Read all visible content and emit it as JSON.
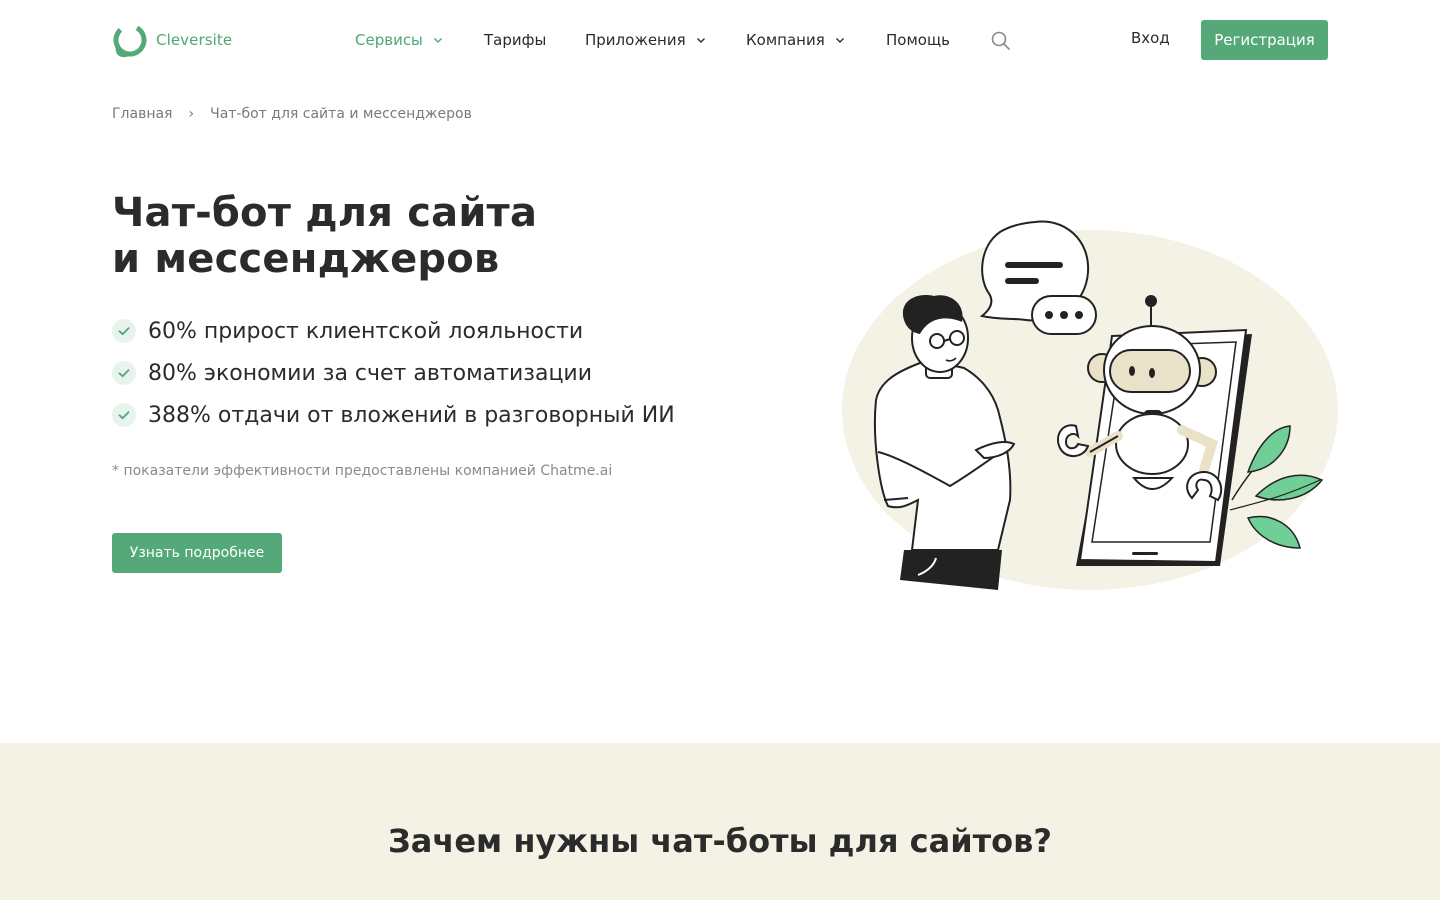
{
  "header": {
    "logo_text": "Cleversite",
    "nav": [
      {
        "label": "Сервисы",
        "has_dropdown": true,
        "active": true
      },
      {
        "label": "Тарифы",
        "has_dropdown": false,
        "active": false
      },
      {
        "label": "Приложения",
        "has_dropdown": true,
        "active": false
      },
      {
        "label": "Компания",
        "has_dropdown": true,
        "active": false
      },
      {
        "label": "Помощь",
        "has_dropdown": false,
        "active": false
      }
    ],
    "search_icon": "search-icon",
    "login_label": "Вход",
    "register_label": "Регистрация"
  },
  "breadcrumb": {
    "items": [
      "Главная",
      "Чат-бот для сайта и мессенджеров"
    ],
    "separator": "›"
  },
  "hero": {
    "title_line1": "Чат-бот для сайта",
    "title_line2": "и мессенджеров",
    "features": [
      "60% прирост клиентской лояльности",
      "80% экономии за счет автоматизации",
      "388% отдачи от вложений в разговорный ИИ"
    ],
    "footnote": "* показатели эффективности предоставлены компанией Chatme.ai",
    "cta_label": "Узнать подробнее"
  },
  "section": {
    "title": "Зачем нужны чат-боты для сайтов?"
  },
  "colors": {
    "accent": "#55a978",
    "accent_text": "#4fa776",
    "text": "#2b2b2b",
    "muted": "#7a7a7a",
    "section_bg": "#f4f1e5",
    "illustration_bg": "#f4f1e5",
    "leaf": "#6fcf97"
  }
}
